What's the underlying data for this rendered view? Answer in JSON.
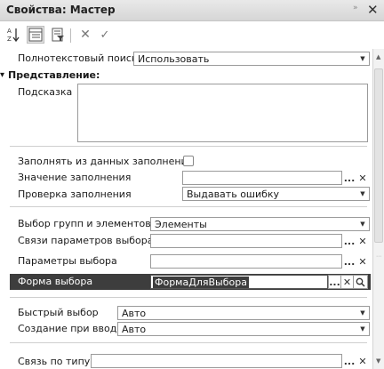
{
  "window": {
    "title": "Свойства: Мастер",
    "pin_glyph": "»",
    "close_glyph": "✕"
  },
  "toolbar": {
    "sort_icon_label": "A↓Z",
    "cancel_glyph": "✕",
    "check_glyph": "✓"
  },
  "properties": {
    "fulltext_search": {
      "label": "Полнотекстовый поиск",
      "value": "Использовать"
    },
    "presentation_section": "Представление:",
    "section_arrow": "▾",
    "hint": {
      "label": "Подсказка",
      "value": ""
    },
    "fill_from_data": {
      "label": "Заполнять из данных заполнения",
      "checked": false
    },
    "fill_value": {
      "label": "Значение заполнения",
      "value": ""
    },
    "fill_check": {
      "label": "Проверка заполнения",
      "value": "Выдавать ошибку"
    },
    "select_groups_items": {
      "label": "Выбор групп и элементов",
      "value": "Элементы"
    },
    "choice_param_links": {
      "label": "Связи параметров выбора",
      "value": ""
    },
    "choice_params": {
      "label": "Параметры выбора",
      "value": ""
    },
    "choice_form": {
      "label": "Форма выбора",
      "value": "ФормаДляВыбора",
      "selected": true
    },
    "quick_choice": {
      "label": "Быстрый выбор",
      "value": "Авто"
    },
    "create_on_input": {
      "label": "Создание при вводе",
      "value": "Авто"
    },
    "type_link": {
      "label": "Связь по типу",
      "value": ""
    }
  },
  "buttons": {
    "ellipsis": "...",
    "clear": "✕",
    "dropdown": "▼",
    "search_glyph": "⌕"
  },
  "scrollbar": {
    "up": "▲",
    "down": "▼",
    "grip": "⋯"
  }
}
